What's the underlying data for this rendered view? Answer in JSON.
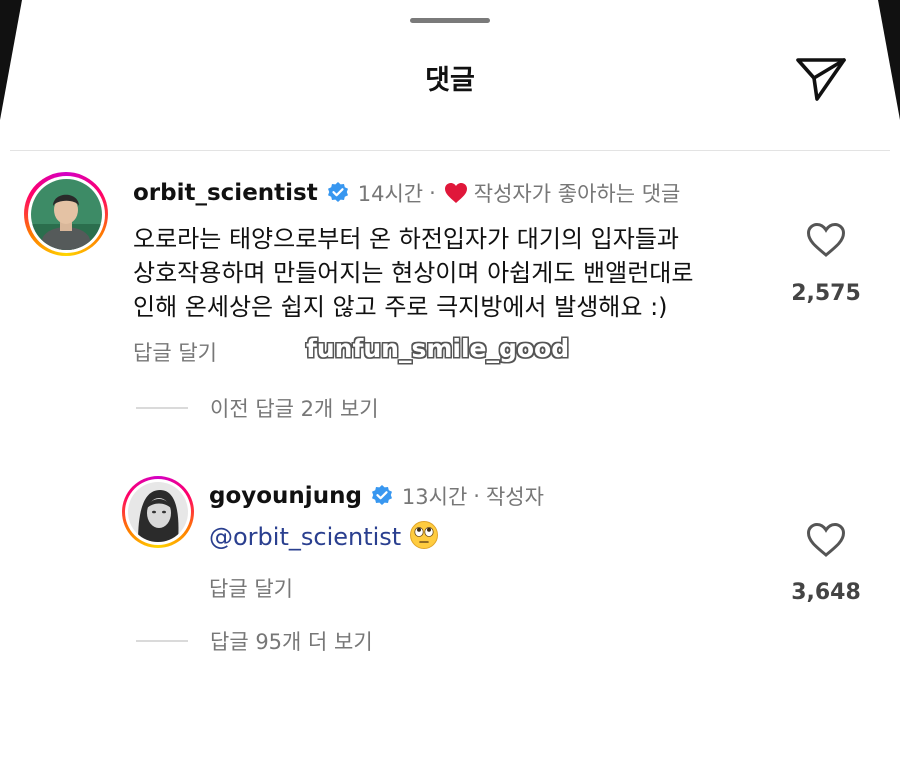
{
  "header": {
    "title": "댓글"
  },
  "comments": [
    {
      "username": "orbit_scientist",
      "time": "14시간",
      "badge": "작성자가 좋아하는 댓글",
      "lines": [
        "오로라는 태양으로부터 온 하전입자가 대기의 입자들과",
        "상호작용하며 만들어지는 현상이며 아쉽게도 밴앨런대로",
        "인해 온세상은 쉽지 않고 주로 극지방에서 발생해요 :)"
      ],
      "reply_label": "답글 달기",
      "like_count": "2,575",
      "watermark": "funfun_smile_good",
      "view_previous": "이전 답글 2개 보기"
    },
    {
      "username": "goyounjung",
      "time": "13시간",
      "badge": "작성자",
      "mention": "@orbit_scientist",
      "emoji": "rolling-eyes-emoji",
      "reply_label": "답글 달기",
      "like_count": "3,648",
      "view_more": "답글 95개 더 보기"
    }
  ],
  "colors": {
    "mention": "#2a3f8f",
    "verified": "#3897f0",
    "heart": "#e0173a",
    "muted": "#777777"
  }
}
